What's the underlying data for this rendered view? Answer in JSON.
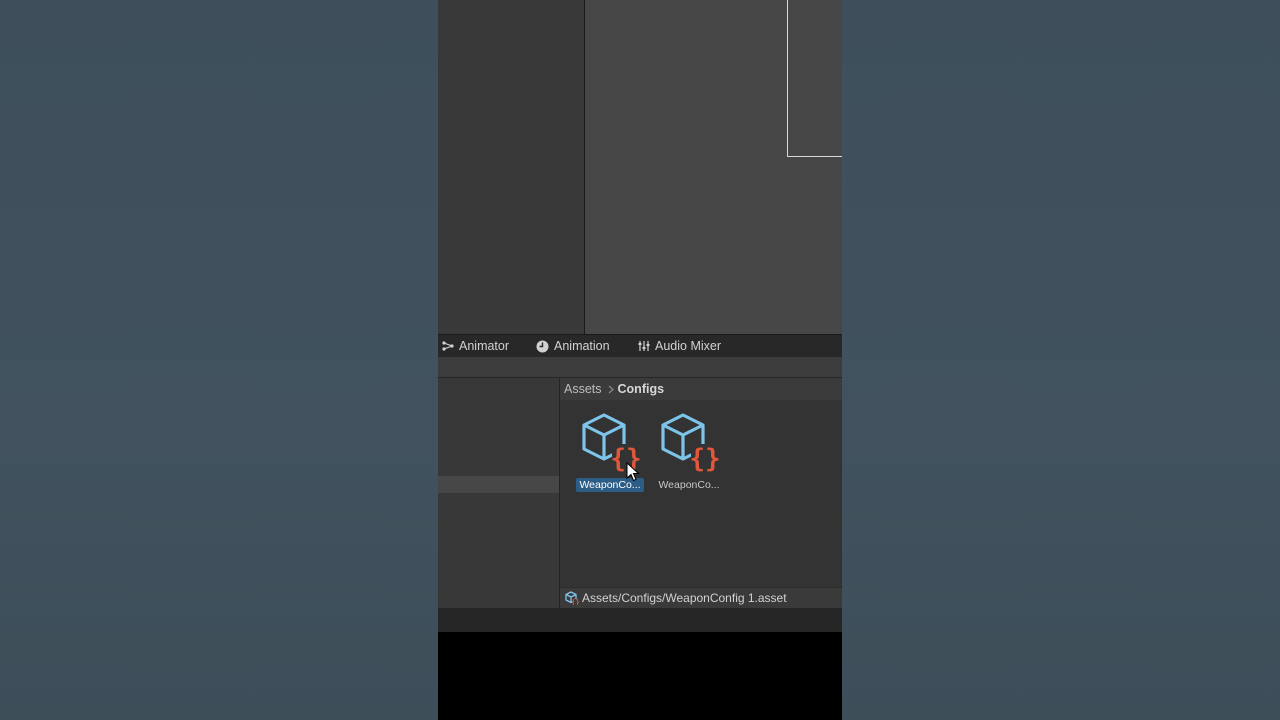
{
  "tabs": [
    {
      "label": "Animator",
      "icon": "animator-icon"
    },
    {
      "label": "Animation",
      "icon": "clock-icon"
    },
    {
      "label": "Audio Mixer",
      "icon": "mixer-icon"
    }
  ],
  "breadcrumb": {
    "root": "Assets",
    "current": "Configs"
  },
  "assets": [
    {
      "label": "WeaponCo...",
      "selected": true,
      "icon": "scriptable-object-icon"
    },
    {
      "label": "WeaponCo...",
      "selected": false,
      "icon": "scriptable-object-icon"
    }
  ],
  "status": {
    "path": "Assets/Configs/WeaponConfig 1.asset"
  },
  "colors": {
    "cube": "#7dc4ea",
    "braces": "#e0573c",
    "selection": "#2c5d87"
  }
}
